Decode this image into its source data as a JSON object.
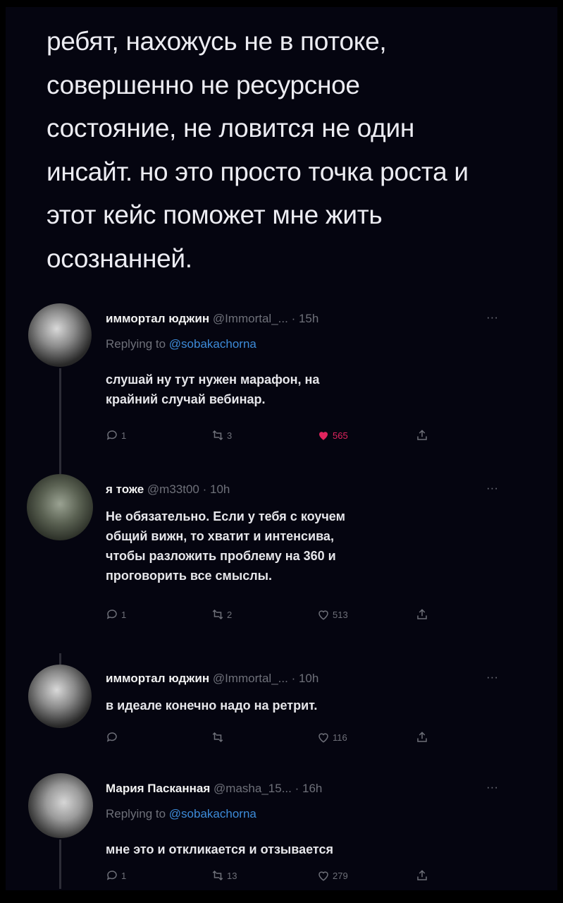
{
  "main_tweet": {
    "lines": [
      "ребят, нахожусь не в потоке,",
      "совершенно не ресурсное",
      "состояние, не ловится не один",
      "инсайт. но это просто точка роста и",
      "этот кейс поможет мне жить",
      "осознанней."
    ]
  },
  "replies": [
    {
      "name": "иммортал юджин",
      "handle": "@Immortal_...",
      "time": "· 15h",
      "replying_prefix": "Replying to",
      "replying_to": "@sobakachorna",
      "body": [
        "слушай ну тут нужен марафон, на",
        "крайний случай вебинар."
      ],
      "counts": {
        "reply": "1",
        "retweet": "3",
        "like": "565"
      },
      "liked": true
    },
    {
      "name": "я тоже",
      "handle": "@m33t00",
      "time": "· 10h",
      "body": [
        "Не обязательно. Если у тебя с коучем",
        "общий вижн, то хватит и интенсива,",
        "чтобы разложить проблему на 360 и",
        "проговорить все смыслы."
      ],
      "counts": {
        "reply": "1",
        "retweet": "2",
        "like": "513"
      }
    },
    {
      "name": "иммортал юджин",
      "handle": "@Immortal_...",
      "time": "· 10h",
      "body": [
        "в идеале конечно надо на ретрит."
      ],
      "counts": {
        "reply": "",
        "retweet": "",
        "like": "116"
      }
    },
    {
      "name": "Мария Пасканная",
      "handle": "@masha_15...",
      "time": "· 16h",
      "replying_prefix": "Replying to",
      "replying_to": "@sobakachorna",
      "body": [
        "мне это и откликается и отзывается"
      ],
      "counts": {
        "reply": "1",
        "retweet": "13",
        "like": "279"
      }
    }
  ],
  "more_symbol": "···",
  "colors": {
    "background": "#050510",
    "mention": "#3d8bd8",
    "muted": "#6e7079",
    "like_active": "#e0245e"
  }
}
